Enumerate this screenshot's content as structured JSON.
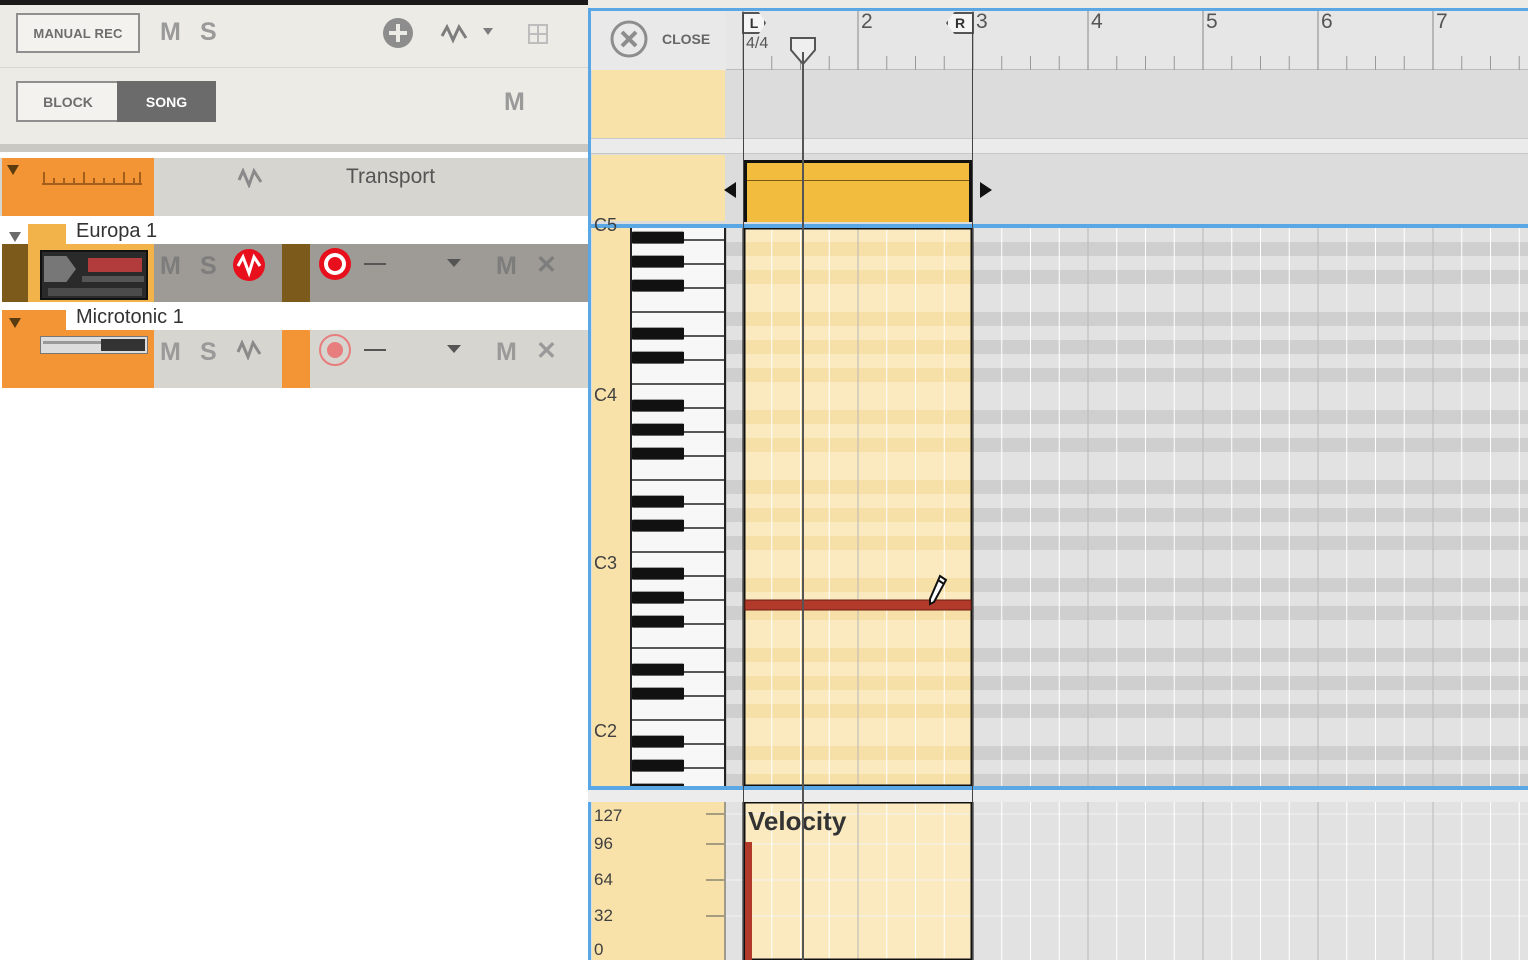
{
  "toolbar": {
    "manual_rec_label": "MANUAL REC",
    "mute_label": "M",
    "solo_label": "S",
    "block_label": "BLOCK",
    "song_label": "SONG",
    "master_mute_label": "M"
  },
  "tracks": [
    {
      "name": "Transport",
      "kind": "transport"
    },
    {
      "name": "Europa 1",
      "mute": "M",
      "solo": "S",
      "lane_mute": "M",
      "lane_delete": "✕",
      "record_active": true
    },
    {
      "name": "Microtonic 1",
      "mute": "M",
      "solo": "S",
      "lane_mute": "M",
      "lane_delete": "✕",
      "record_active": false
    }
  ],
  "editor": {
    "close_label": "CLOSE",
    "time_signature": "4/4",
    "ruler_bars": [
      "2",
      "3",
      "4",
      "5",
      "6",
      "7"
    ],
    "left_locator": "L",
    "right_locator": "R",
    "octave_labels": [
      "C5",
      "C4",
      "C3",
      "C2"
    ],
    "velocity_title": "Velocity",
    "velocity_scale": [
      "127",
      "96",
      "64",
      "32",
      "0"
    ]
  },
  "colors": {
    "track_orange": "#f39534",
    "clip_yellow": "#f2bd3f",
    "note_red": "#b23a2a",
    "cream": "#f8e2aa",
    "selection_blue": "#5aa7e6",
    "record_red": "#e8101d"
  }
}
